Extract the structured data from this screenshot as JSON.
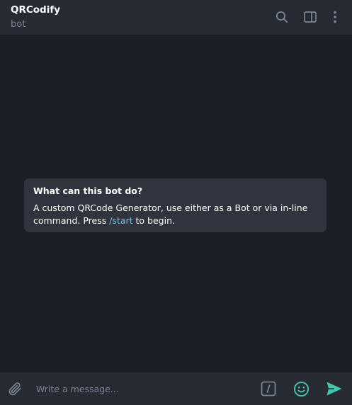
{
  "header": {
    "title": "QRCodify",
    "subtitle": "bot",
    "icons": [
      "search-icon",
      "sidebar-panel-icon",
      "more-vert-icon"
    ]
  },
  "chat": {
    "bot_info": {
      "title": "What can this bot do?",
      "description_before": "A custom QRCode Generator, use either as a Bot or via in-line command. Press ",
      "command": "/start",
      "description_after": " to begin."
    }
  },
  "composer": {
    "placeholder": "Write a message...",
    "icons": [
      "paperclip-icon",
      "bot-commands-icon",
      "emoji-icon",
      "send-icon"
    ]
  },
  "colors": {
    "header_bg": "#292b33",
    "chat_bg": "#1e1f24",
    "card_bg": "#31343c",
    "link": "#6ac2f1",
    "send_accent": "#40c8ae",
    "muted_text": "#7c8592"
  }
}
